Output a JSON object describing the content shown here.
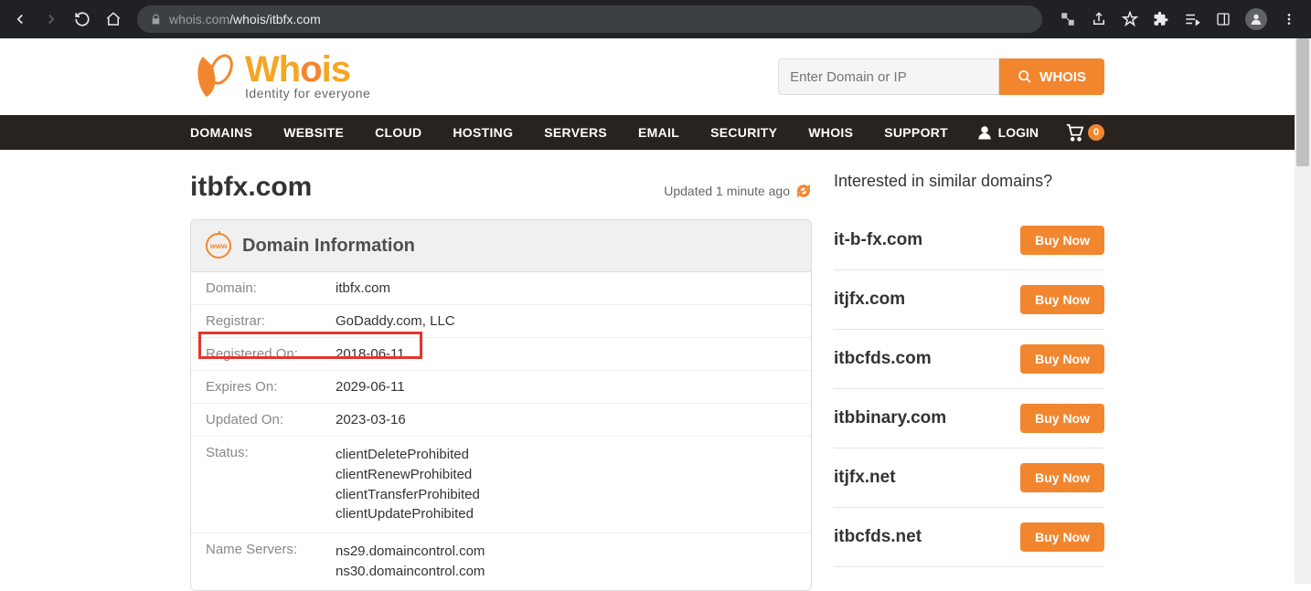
{
  "browser": {
    "url_host": "whois.com",
    "url_path": "/whois/itbfx.com"
  },
  "header": {
    "logo_main_1": "Wh",
    "logo_main_2": "o",
    "logo_main_3": "is",
    "logo_sub": "Identity for everyone",
    "search_placeholder": "Enter Domain or IP",
    "search_btn": "WHOIS"
  },
  "nav": {
    "items": [
      "DOMAINS",
      "WEBSITE",
      "CLOUD",
      "HOSTING",
      "SERVERS",
      "EMAIL",
      "SECURITY",
      "WHOIS",
      "SUPPORT"
    ],
    "login": "LOGIN",
    "cart_count": "0"
  },
  "main": {
    "title": "itbfx.com",
    "updated_text": "Updated 1 minute ago",
    "card_title": "Domain Information",
    "info": [
      {
        "label": "Domain:",
        "value": "itbfx.com"
      },
      {
        "label": "Registrar:",
        "value": "GoDaddy.com, LLC"
      },
      {
        "label": "Registered On:",
        "value": "2018-06-11"
      },
      {
        "label": "Expires On:",
        "value": "2029-06-11"
      },
      {
        "label": "Updated On:",
        "value": "2023-03-16"
      }
    ],
    "status_label": "Status:",
    "status_values": [
      "clientDeleteProhibited",
      "clientRenewProhibited",
      "clientTransferProhibited",
      "clientUpdateProhibited"
    ],
    "ns_label": "Name Servers:",
    "ns_values": [
      "ns29.domaincontrol.com",
      "ns30.domaincontrol.com"
    ]
  },
  "similar": {
    "title": "Interested in similar domains?",
    "buy_label": "Buy Now",
    "items": [
      "it-b-fx.com",
      "itjfx.com",
      "itbcfds.com",
      "itbbinary.com",
      "itjfx.net",
      "itbcfds.net"
    ]
  },
  "colors": {
    "accent": "#f2862e"
  }
}
